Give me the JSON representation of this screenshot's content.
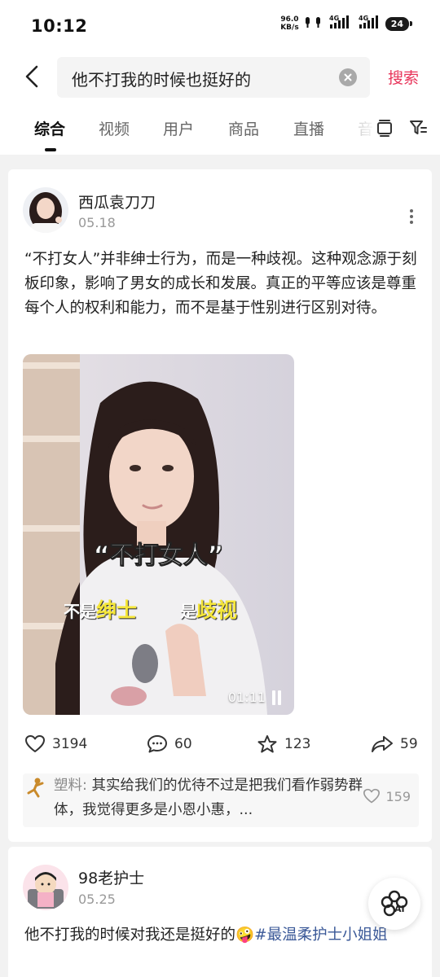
{
  "status_bar": {
    "time": "10:12",
    "net_speed_value": "96.0",
    "net_speed_unit": "KB/s",
    "signal1_label": "4G",
    "signal2_label": "4G",
    "battery": "24"
  },
  "search": {
    "query": "他不打我的时候也挺好的",
    "button_label": "搜索"
  },
  "tabs": [
    {
      "label": "综合",
      "active": true
    },
    {
      "label": "视频"
    },
    {
      "label": "用户"
    },
    {
      "label": "商品"
    },
    {
      "label": "直播"
    },
    {
      "label": "音"
    }
  ],
  "posts": [
    {
      "username": "西瓜袁刀刀",
      "date": "05.18",
      "text": "“不打女人”并非绅士行为，而是一种歧视。这种观念源于刻板印象，影响了男女的成长和发展。真正的平等应该是尊重每个人的权利和能力，而不是基于性别进行区别对待。",
      "video": {
        "caption_main": "“不打女人”",
        "caption_left_prefix": "不是",
        "caption_left_highlight": "绅士",
        "caption_right_prefix": "是",
        "caption_right_highlight": "歧视",
        "duration": "01:11"
      },
      "likes": "3194",
      "comments": "60",
      "favorites": "123",
      "shares": "59",
      "top_comment": {
        "author": "塑料:",
        "text": " 其实给我们的优待不过是把我们看作弱势群体，我觉得更多是小恩小惠，...",
        "likes": "159"
      }
    },
    {
      "username": "98老护士",
      "date": "05.25",
      "text_before": "他不打我的时候对我还是挺好的",
      "emoji": "🤪",
      "hashtag": "#最温柔护士小姐姐"
    }
  ],
  "ai_button": {
    "label": "AI"
  },
  "colors": {
    "accent": "#e8345a",
    "hashtag": "#3b5998",
    "caption_yellow": "#f5e63a"
  }
}
